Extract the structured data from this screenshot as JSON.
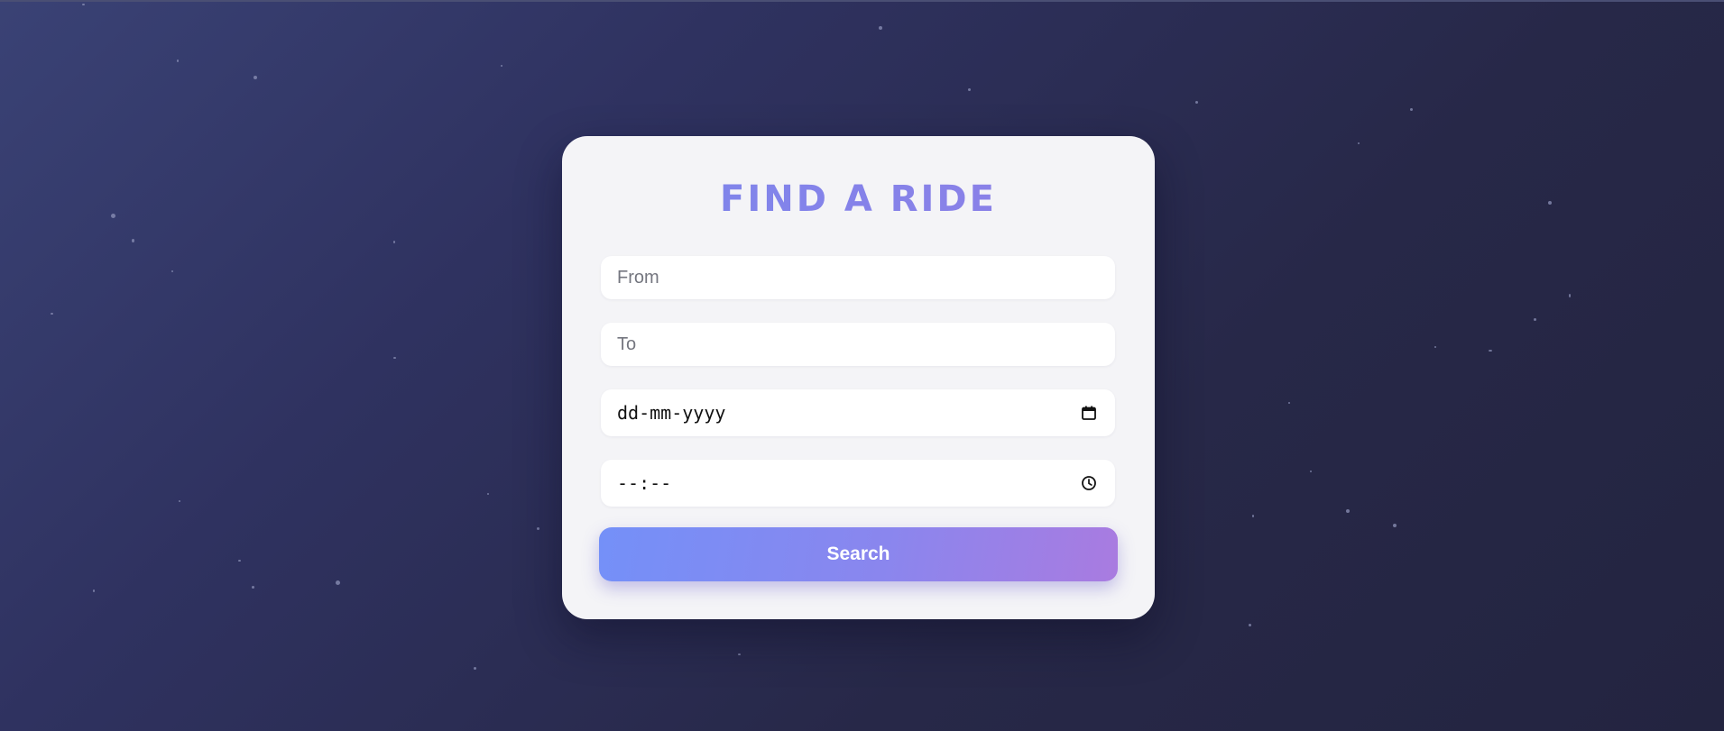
{
  "form": {
    "title": "FIND A RIDE",
    "from": {
      "placeholder": "From",
      "value": ""
    },
    "to": {
      "placeholder": "To",
      "value": ""
    },
    "date": {
      "display": "dd-mm-yyyy",
      "icon": "calendar-icon"
    },
    "time": {
      "display": "--:--",
      "icon": "clock-icon"
    },
    "search_label": "Search"
  },
  "colors": {
    "background": "#2b2d52",
    "card": "#f4f4f7",
    "title": "#8184ea",
    "button_start": "#7490f8",
    "button_end": "#a97be0"
  }
}
